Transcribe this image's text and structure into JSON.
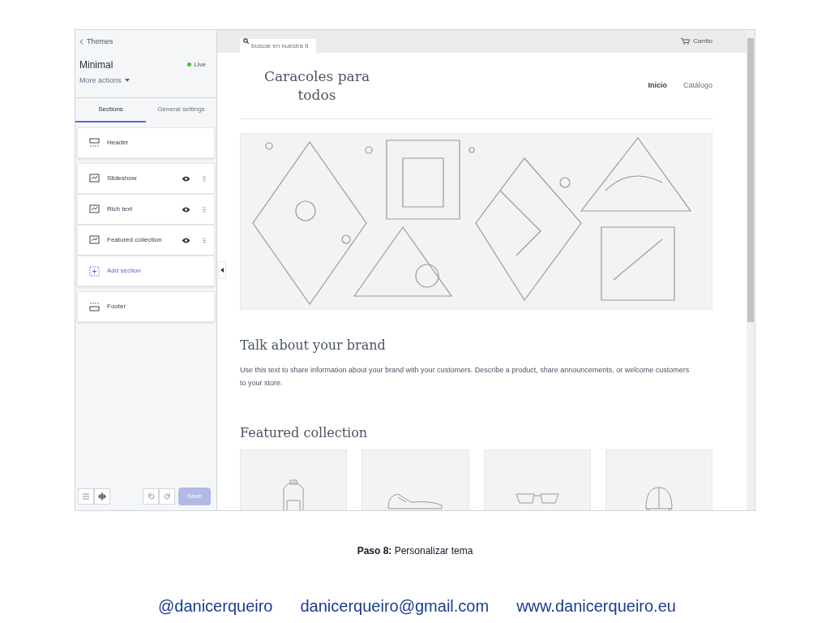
{
  "sidebar": {
    "back_link": "Themes",
    "theme_name": "Minimal",
    "status": {
      "label": "Live",
      "color": "#50b83c"
    },
    "more_actions": "More actions",
    "tabs": [
      {
        "label": "Sections",
        "selected": true
      },
      {
        "label": "General settings",
        "selected": false
      }
    ],
    "sections": [
      {
        "kind": "fixed",
        "label": "Header"
      },
      {
        "kind": "movable",
        "label": "Slideshow",
        "visible": true
      },
      {
        "kind": "movable",
        "label": "Rich text",
        "visible": true
      },
      {
        "kind": "movable",
        "label": "Featured collection",
        "visible": true
      },
      {
        "kind": "add",
        "label": "Add section"
      },
      {
        "kind": "fixed",
        "label": "Footer"
      }
    ],
    "save": {
      "label": "Save",
      "disabled": true
    }
  },
  "preview": {
    "search_placeholder": "buscar en nuestra ti",
    "cart": "Carrito",
    "store_name": "Caracoles para todos",
    "nav": [
      {
        "label": "Inicio",
        "selected": true
      },
      {
        "label": "Catálogo",
        "selected": false
      }
    ],
    "brand_title": "Talk about your brand",
    "brand_text": "Use this text to share information about your brand with your customers. Describe a product, share announcements, or welcome customers to your store.",
    "collection_title": "Featured collection"
  },
  "caption": "**Paso 8:** Personalizar tema",
  "footer": [
    "@danicerqueiro",
    "danicerqueiro@gmail.com",
    "www.danicerqueiro.eu"
  ]
}
